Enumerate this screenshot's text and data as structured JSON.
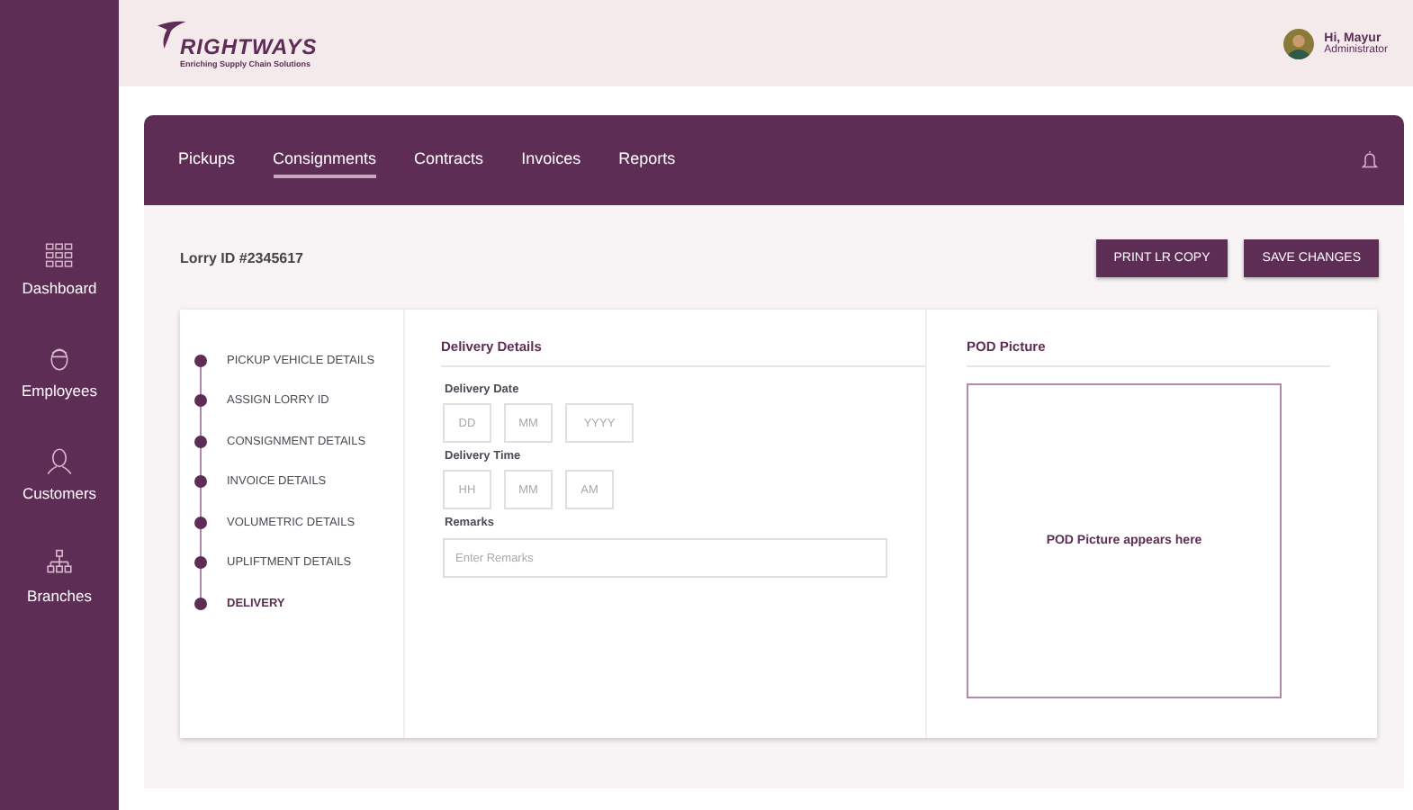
{
  "sidebar": {
    "items": [
      {
        "label": "Dashboard"
      },
      {
        "label": "Employees"
      },
      {
        "label": "Customers"
      },
      {
        "label": "Branches"
      }
    ]
  },
  "header": {
    "logo": "RIGHTWAYS",
    "tagline": "Enriching Supply Chain Solutions",
    "user": {
      "greeting": "Hi, Mayur",
      "role": "Administrator"
    }
  },
  "tabs": [
    {
      "label": "Pickups",
      "selected": false
    },
    {
      "label": "Consignments",
      "selected": true
    },
    {
      "label": "Contracts",
      "selected": false
    },
    {
      "label": "Invoices",
      "selected": false
    },
    {
      "label": "Reports",
      "selected": false
    }
  ],
  "lorry_id": "Lorry ID #2345617",
  "buttons": [
    "PRINT LR COPY",
    "SAVE CHANGES"
  ],
  "steps": [
    {
      "label": "PICKUP VEHICLE DETAILS",
      "selected": false
    },
    {
      "label": "ASSIGN LORRY ID",
      "selected": false
    },
    {
      "label": "CONSIGNMENT DETAILS",
      "selected": false
    },
    {
      "label": "INVOICE DETAILS",
      "selected": false
    },
    {
      "label": "VOLUMETRIC DETAILS",
      "selected": false
    },
    {
      "label": "UPLIFTMENT DETAILS",
      "selected": false
    },
    {
      "label": "DELIVERY",
      "selected": true
    }
  ],
  "delivery": {
    "title": "Delivery Details",
    "date": {
      "label": "Delivery Date",
      "fields": [
        {
          "placeholder": "DD"
        },
        {
          "placeholder": "MM"
        },
        {
          "placeholder": "YYYY"
        }
      ]
    },
    "time": {
      "label": "Delivery Time",
      "fields": [
        {
          "placeholder": "HH"
        },
        {
          "placeholder": "MM"
        },
        {
          "placeholder": "AM"
        }
      ]
    },
    "remarks": {
      "label": "Remarks",
      "placeholder": "Enter Remarks"
    }
  },
  "pod": {
    "title": "POD Picture",
    "empty_text": "POD Picture appears here"
  }
}
